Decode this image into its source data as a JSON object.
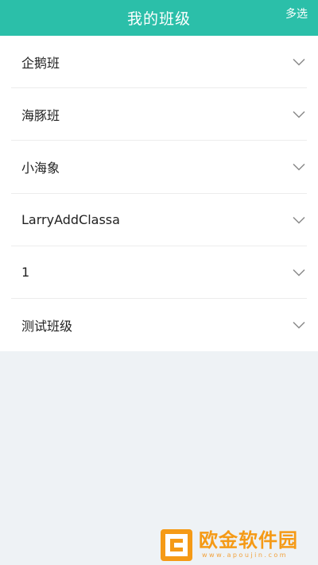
{
  "header": {
    "title": "我的班级",
    "action_label": "多选"
  },
  "classes": [
    {
      "name": "企鹅班"
    },
    {
      "name": "海豚班"
    },
    {
      "name": "小海象"
    },
    {
      "name": "LarryAddClassa"
    },
    {
      "name": "1"
    },
    {
      "name": "测试班级"
    }
  ],
  "watermark": {
    "brand": [
      "欧",
      "金",
      "软",
      "件",
      "园"
    ],
    "url": "www.apoujin.com"
  },
  "colors": {
    "header_bg": "#2bbfa9",
    "watermark_orange": "#f59a16"
  }
}
